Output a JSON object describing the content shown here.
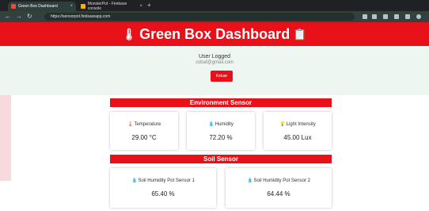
{
  "browser": {
    "tabs": [
      {
        "title": "Green Box Dashboard",
        "active": true,
        "favicon_color": "#e74c3c"
      },
      {
        "title": "MonsterPot - Firebase console",
        "active": false,
        "favicon_color": "#f5b400"
      }
    ],
    "new_tab": "+",
    "url": "https://sensorpot.firebaseapp.com"
  },
  "header": {
    "title": "Green Box Dashboard",
    "left_icon": "thermometer-icon",
    "right_icon": "clipboard-icon"
  },
  "user": {
    "label": "User Logged",
    "email": "cobaf@gmail.com",
    "logout_label": "Keluar"
  },
  "environment": {
    "heading": "Environment Sensor",
    "cards": [
      {
        "title": "Temperature",
        "value": "29.00 °C",
        "icon": "thermometer-icon",
        "icon_color": "#e74c3c"
      },
      {
        "title": "Humidity",
        "value": "72.20 %",
        "icon": "droplet-icon",
        "icon_color": "#2a8bd6"
      },
      {
        "title": "Light Intensity",
        "value": "45.00 Lux",
        "icon": "bulb-icon",
        "icon_color": "#f0b400"
      }
    ]
  },
  "soil": {
    "heading": "Soil Sensor",
    "cards": [
      {
        "title": "Soil Humidity Pot Sensor 1",
        "value": "65.40 %",
        "icon": "droplet-icon",
        "icon_color": "#2a8bd6"
      },
      {
        "title": "Soil Humidity Pot Sensor 2",
        "value": "64.44 %",
        "icon": "droplet-icon",
        "icon_color": "#2a8bd6"
      }
    ]
  },
  "colors": {
    "accent": "#e8111a",
    "user_panel_bg": "#eef6f1",
    "browser_chrome": "#202124"
  }
}
